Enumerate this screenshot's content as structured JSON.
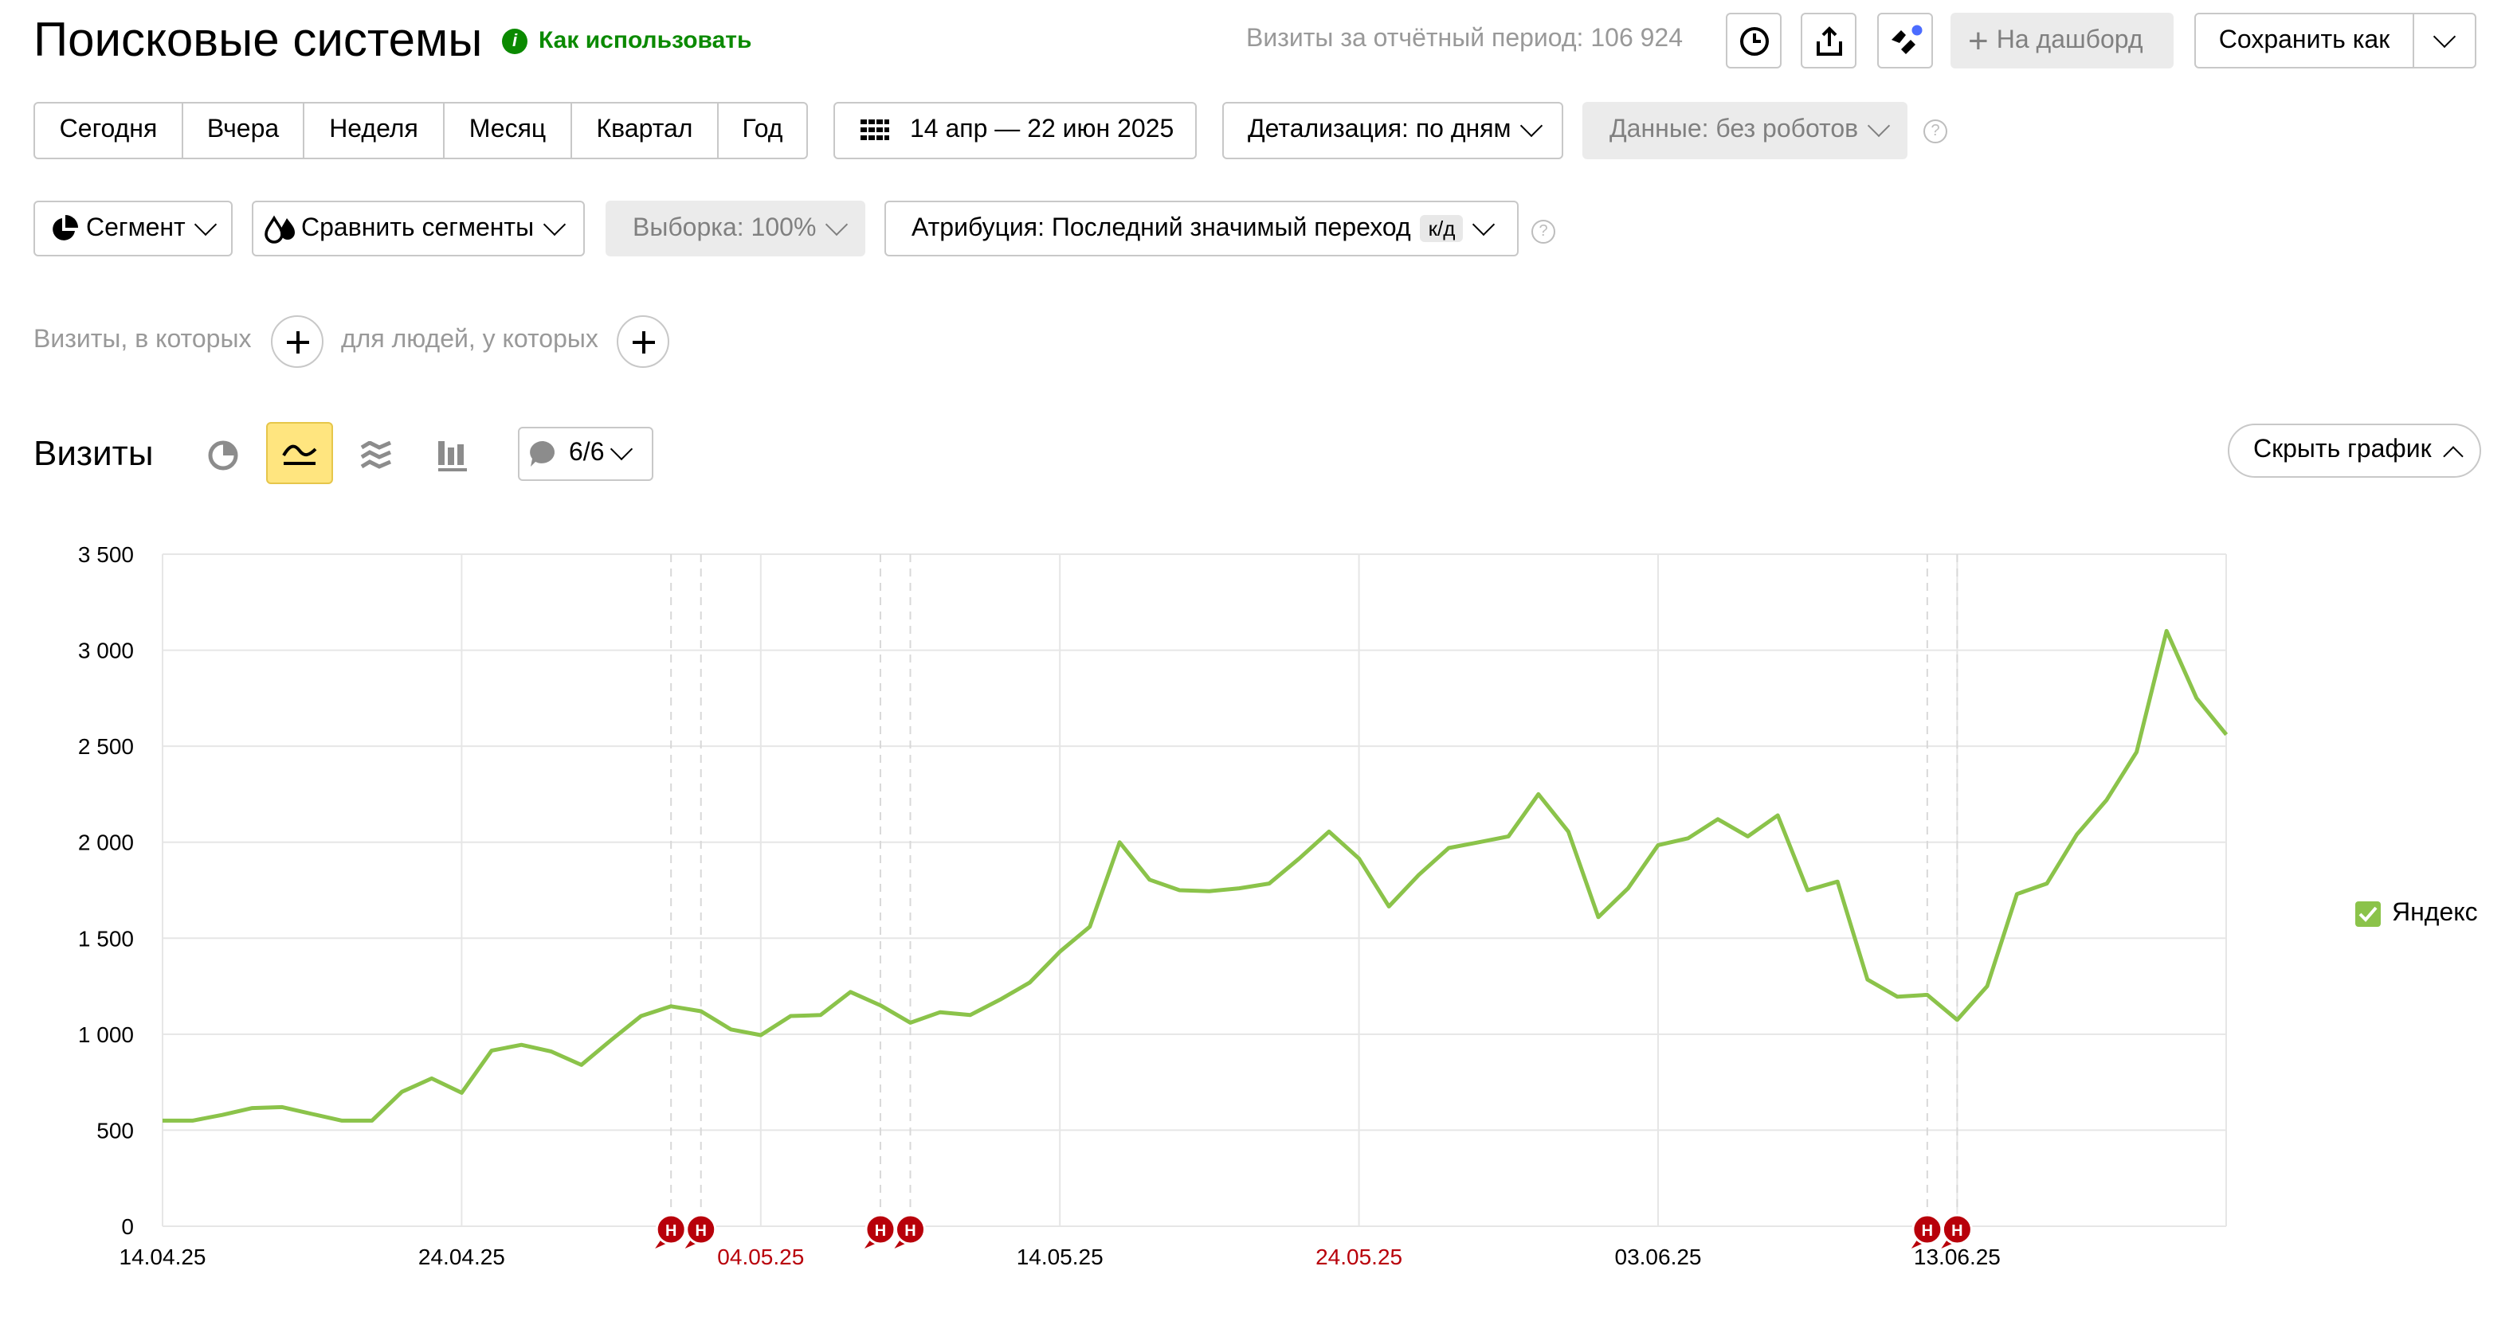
{
  "header": {
    "title": "Поисковые системы",
    "how_to_use": "Как использовать",
    "visits_total_label": "Визиты за отчётный период:",
    "visits_total_value": "106 924",
    "to_dashboard": "На дашборд",
    "save_as": "Сохранить как"
  },
  "periods": [
    "Сегодня",
    "Вчера",
    "Неделя",
    "Месяц",
    "Квартал",
    "Год"
  ],
  "date_range": "14 апр — 22 июн 2025",
  "detail": "Детализация: по дням",
  "data_filter": "Данные: без роботов",
  "segment": "Сегмент",
  "compare_segments": "Сравнить сегменты",
  "sample": "Выборка: 100%",
  "attribution": "Атрибуция: Последний значимый переход",
  "attribution_badge": "к/д",
  "filters": {
    "visits_where": "Визиты, в которых",
    "people_where": "для людей, у которых"
  },
  "graph": {
    "title": "Визиты",
    "annotations_count": "6/6",
    "hide_graph": "Скрыть график"
  },
  "colors": {
    "accent": "#ffe57f",
    "series": "#8bc34a",
    "holiday": "#b8000a"
  },
  "chart_data": {
    "type": "line",
    "ylim": [
      0,
      3500
    ],
    "yticks": [
      "0",
      "500",
      "1 000",
      "1 500",
      "2 000",
      "2 500",
      "3 000",
      "3 500"
    ],
    "xticks": [
      {
        "label": "14.04.25",
        "day": 0,
        "holiday": false
      },
      {
        "label": "24.04.25",
        "day": 10,
        "holiday": false
      },
      {
        "label": "04.05.25",
        "day": 20,
        "holiday": true
      },
      {
        "label": "14.05.25",
        "day": 30,
        "holiday": false
      },
      {
        "label": "24.05.25",
        "day": 40,
        "holiday": true
      },
      {
        "label": "03.06.25",
        "day": 50,
        "holiday": false
      },
      {
        "label": "13.06.25",
        "day": 60,
        "holiday": false
      }
    ],
    "annotations": [
      {
        "label": "Н",
        "day": 17
      },
      {
        "label": "Н",
        "day": 18
      },
      {
        "label": "Н",
        "day": 24
      },
      {
        "label": "Н",
        "day": 25
      },
      {
        "label": "Н",
        "day": 59
      },
      {
        "label": "Н",
        "day": 60
      }
    ],
    "series": [
      {
        "name": "Яндекс",
        "values": [
          550,
          550,
          580,
          615,
          620,
          585,
          550,
          550,
          700,
          770,
          695,
          915,
          945,
          910,
          840,
          970,
          1095,
          1145,
          1120,
          1025,
          995,
          1095,
          1100,
          1220,
          1150,
          1060,
          1115,
          1100,
          1180,
          1270,
          1430,
          1560,
          2000,
          1805,
          1750,
          1745,
          1760,
          1785,
          1915,
          2055,
          1915,
          1665,
          1830,
          1970,
          2000,
          2030,
          2250,
          2055,
          1610,
          1760,
          1985,
          2020,
          2120,
          2030,
          2140,
          1750,
          1795,
          1285,
          1195,
          1205,
          1075,
          1250,
          1730,
          1785,
          2040,
          2220,
          2470,
          3100,
          2750,
          2560
        ]
      }
    ]
  }
}
